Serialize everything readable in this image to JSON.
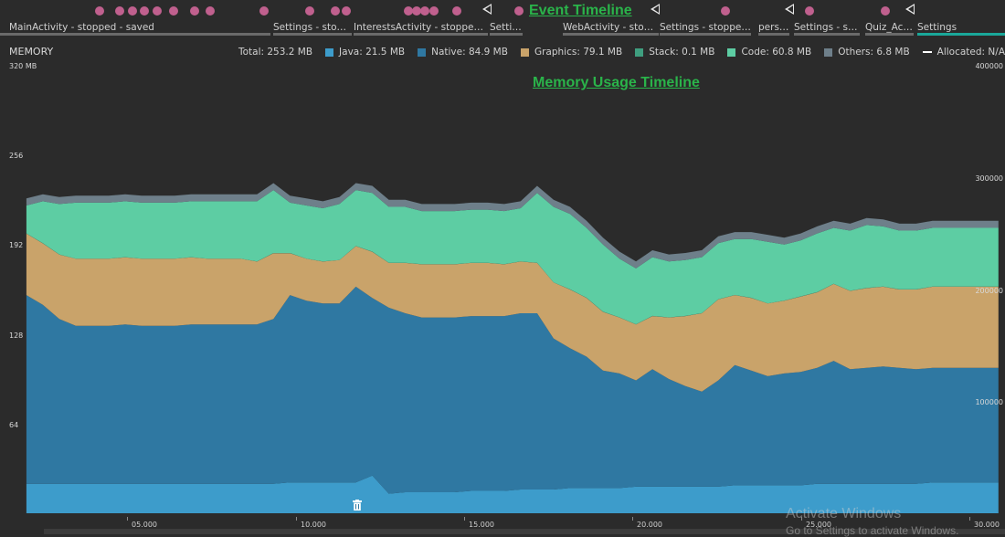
{
  "overlay": {
    "event_timeline_title": "Event Timeline",
    "memory_timeline_title": "Memory Usage Timeline"
  },
  "activities": [
    {
      "label": "MainActivity - stopped - saved"
    },
    {
      "label": "Settings - stopp..."
    },
    {
      "label": "InterestsActivity - stopped - d..."
    },
    {
      "label": "Settin..."
    },
    {
      "label": "WebActivity - stoppe..."
    },
    {
      "label": "Settings - stopped ..."
    },
    {
      "label": "perso..."
    },
    {
      "label": "Settings - sto..."
    },
    {
      "label": "Quiz_Acti..."
    },
    {
      "label": "Settings"
    }
  ],
  "memory": {
    "label": "MEMORY",
    "total": "Total: 253.2 MB",
    "legend": [
      {
        "label": "Java: 21.5 MB",
        "color": "#3d9ccb"
      },
      {
        "label": "Native: 84.9 MB",
        "color": "#2f78a2"
      },
      {
        "label": "Graphics: 79.1 MB",
        "color": "#c9a36a"
      },
      {
        "label": "Stack: 0.1 MB",
        "color": "#3f9e7f"
      },
      {
        "label": "Code: 60.8 MB",
        "color": "#5dcda3"
      },
      {
        "label": "Others: 6.8 MB",
        "color": "#6e7f8a"
      },
      {
        "label": "Allocated: N/A",
        "color": "#ffffff"
      }
    ]
  },
  "y_left_ticks": [
    "320 MB",
    "256",
    "192",
    "128",
    "64"
  ],
  "y_right_ticks": [
    "400000",
    "300000",
    "200000",
    "100000"
  ],
  "x_ticks": [
    "05.000",
    "10.000",
    "15.000",
    "20.000",
    "25.000",
    "30.000"
  ],
  "watermark": {
    "line1": "Activate Windows",
    "line2": "Go to Settings to activate Windows."
  },
  "chart_data": {
    "type": "area",
    "x_seconds": [
      1.0,
      1.5,
      2.0,
      2.5,
      3.0,
      3.5,
      4.0,
      4.5,
      5.0,
      5.5,
      6.0,
      6.5,
      7.0,
      7.5,
      8.0,
      8.5,
      9.0,
      9.5,
      10.0,
      10.5,
      11.0,
      11.5,
      12.0,
      12.5,
      13.0,
      13.5,
      14.0,
      14.5,
      15.0,
      15.5,
      16.0,
      16.5,
      17.0,
      17.5,
      18.0,
      18.5,
      19.0,
      19.5,
      20.0,
      20.5,
      21.0,
      21.5,
      22.0,
      22.5,
      23.0,
      23.5,
      24.0,
      24.5,
      25.0,
      25.5,
      26.0,
      26.5,
      27.0,
      27.5,
      28.0,
      28.5,
      29.0,
      29.5,
      30.0,
      30.5
    ],
    "ylim": [
      0,
      320
    ],
    "series": [
      {
        "name": "Java",
        "values": [
          21,
          21,
          21,
          21,
          21,
          21,
          21,
          21,
          21,
          21,
          21,
          21,
          21,
          21,
          21,
          21,
          22,
          22,
          22,
          22,
          22,
          27,
          14,
          15,
          15,
          15,
          15,
          16,
          16,
          16,
          17,
          17,
          17,
          18,
          18,
          18,
          18,
          19,
          19,
          19,
          19,
          19,
          19,
          20,
          20,
          20,
          20,
          20,
          21,
          21,
          21,
          21,
          21,
          21,
          21,
          22,
          22,
          22,
          22,
          22
        ]
      },
      {
        "name": "Native",
        "values": [
          135,
          128,
          118,
          113,
          113,
          113,
          114,
          113,
          113,
          113,
          114,
          114,
          114,
          114,
          114,
          118,
          134,
          130,
          128,
          128,
          140,
          127,
          133,
          128,
          125,
          125,
          125,
          125,
          125,
          125,
          126,
          126,
          108,
          100,
          94,
          84,
          82,
          76,
          84,
          77,
          72,
          68,
          76,
          86,
          82,
          78,
          80,
          81,
          83,
          88,
          82,
          83,
          84,
          83,
          82,
          82,
          82,
          82,
          82,
          82
        ]
      },
      {
        "name": "Graphics",
        "values": [
          44,
          44,
          46,
          48,
          48,
          48,
          48,
          48,
          48,
          48,
          48,
          47,
          47,
          47,
          45,
          47,
          30,
          30,
          30,
          31,
          29,
          33,
          32,
          36,
          38,
          38,
          38,
          38,
          38,
          37,
          37,
          36,
          40,
          42,
          42,
          42,
          40,
          40,
          38,
          44,
          50,
          56,
          58,
          50,
          52,
          52,
          52,
          54,
          54,
          55,
          56,
          57,
          57,
          56,
          57,
          58,
          58,
          58,
          58,
          58
        ]
      },
      {
        "name": "Stack",
        "values": [
          0.1,
          0.1,
          0.1,
          0.1,
          0.1,
          0.1,
          0.1,
          0.1,
          0.1,
          0.1,
          0.1,
          0.1,
          0.1,
          0.1,
          0.1,
          0.1,
          0.1,
          0.1,
          0.1,
          0.1,
          0.1,
          0.1,
          0.1,
          0.1,
          0.1,
          0.1,
          0.1,
          0.1,
          0.1,
          0.1,
          0.1,
          0.1,
          0.1,
          0.1,
          0.1,
          0.1,
          0.1,
          0.1,
          0.1,
          0.1,
          0.1,
          0.1,
          0.1,
          0.1,
          0.1,
          0.1,
          0.1,
          0.1,
          0.1,
          0.1,
          0.1,
          0.1,
          0.1,
          0.1,
          0.1,
          0.1,
          0.1,
          0.1,
          0.1,
          0.1
        ]
      },
      {
        "name": "Code",
        "values": [
          20,
          30,
          36,
          40,
          40,
          40,
          40,
          40,
          40,
          40,
          40,
          41,
          41,
          41,
          43,
          45,
          36,
          38,
          38,
          40,
          40,
          42,
          40,
          40,
          38,
          38,
          38,
          38,
          38,
          38,
          38,
          50,
          54,
          54,
          50,
          48,
          42,
          40,
          42,
          40,
          40,
          40,
          40,
          40,
          42,
          44,
          40,
          40,
          42,
          40,
          43,
          45,
          43,
          42,
          42,
          42,
          42,
          42,
          42,
          42
        ]
      },
      {
        "name": "Others",
        "values": [
          5,
          5,
          5,
          5,
          5,
          5,
          5,
          5,
          5,
          5,
          5,
          5,
          5,
          5,
          5,
          5,
          5,
          5,
          5,
          5,
          5,
          5,
          5,
          5,
          5,
          5,
          5,
          5,
          5,
          5,
          5,
          5,
          5,
          5,
          5,
          5,
          5,
          5,
          5,
          5,
          5,
          5,
          5,
          5,
          5,
          5,
          5,
          5,
          5,
          5,
          5,
          5,
          5,
          5,
          5,
          5,
          5,
          5,
          5,
          5
        ]
      }
    ]
  }
}
